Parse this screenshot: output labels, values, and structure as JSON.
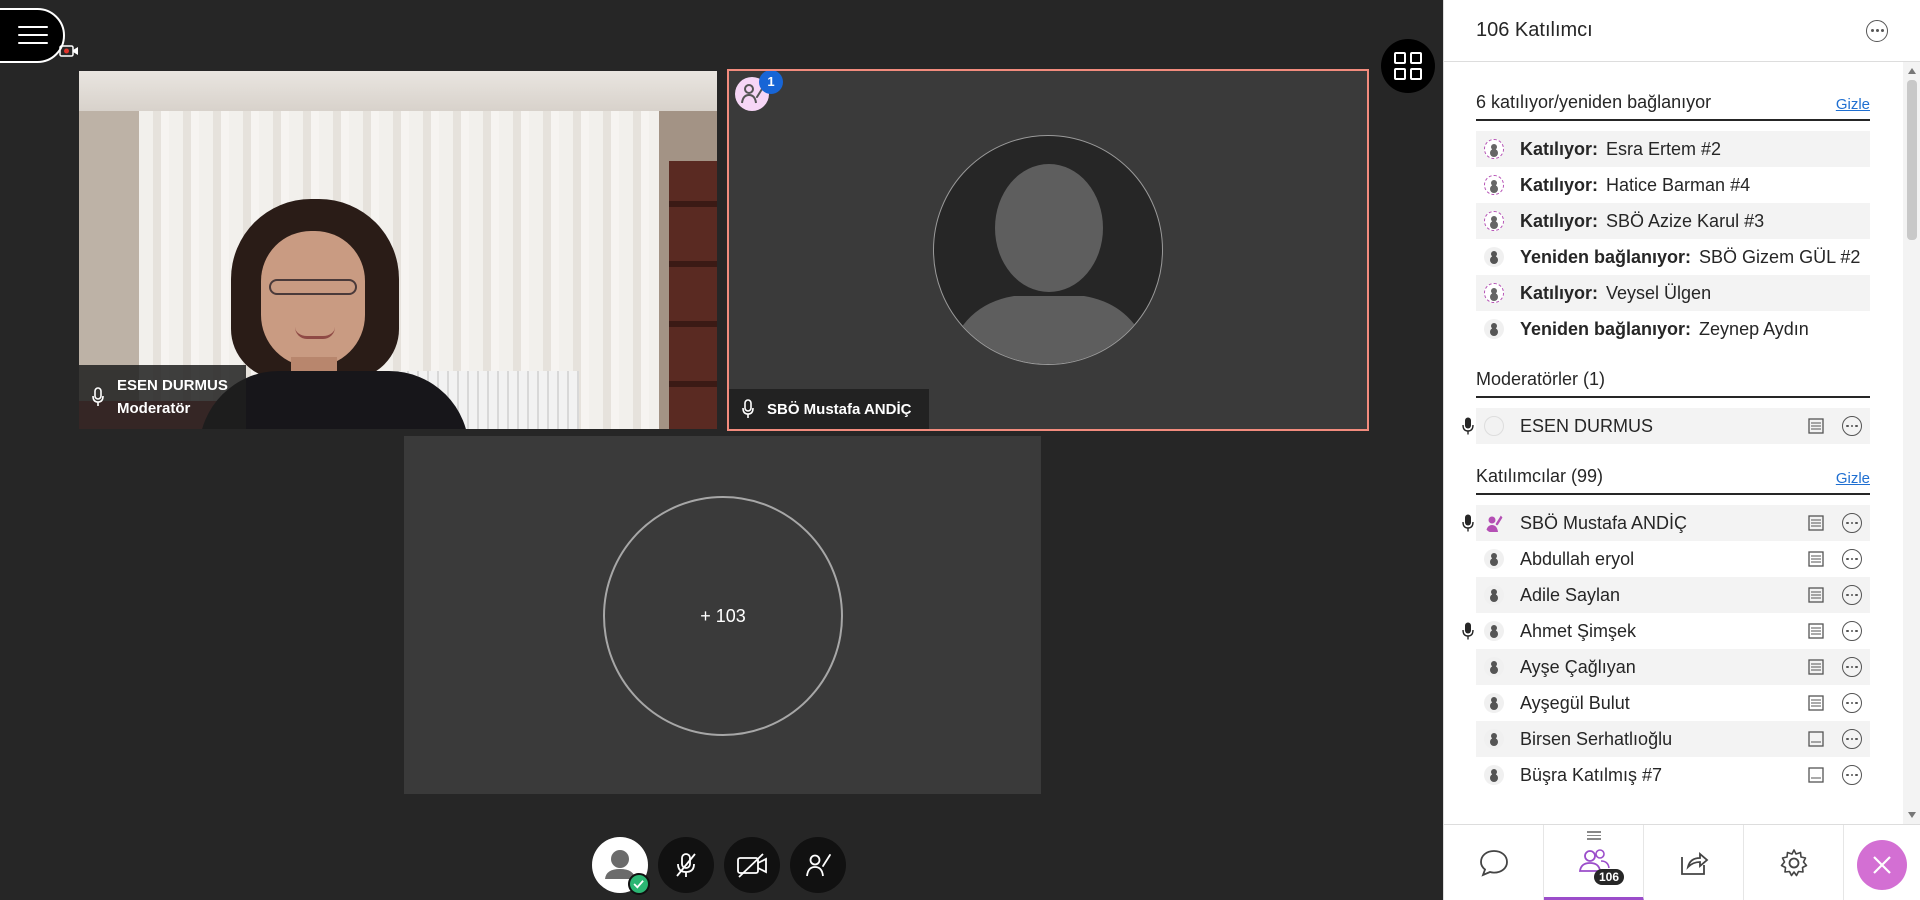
{
  "stage": {
    "tiles": {
      "esen": {
        "name": "ESEN DURMUS",
        "role": "Moderatör"
      },
      "mustafa": {
        "name": "SBÖ Mustafa ANDİÇ",
        "share_badge": "1"
      },
      "more": {
        "label": "+ 103"
      }
    }
  },
  "panel": {
    "title": "106 Katılımcı",
    "joining": {
      "heading": "6 katılıyor/yeniden bağlanıyor",
      "hide": "Gizle",
      "items": [
        {
          "status": "Katılıyor:",
          "name": "Esra Ertem #2"
        },
        {
          "status": "Katılıyor:",
          "name": "Hatice Barman #4"
        },
        {
          "status": "Katılıyor:",
          "name": "SBÖ Azize Karul #3"
        },
        {
          "status": "Yeniden bağlanıyor:",
          "name": "SBÖ Gizem GÜL #2"
        },
        {
          "status": "Katılıyor:",
          "name": "Veysel Ülgen"
        },
        {
          "status": "Yeniden bağlanıyor:",
          "name": "Zeynep Aydın"
        }
      ]
    },
    "moderators": {
      "heading": "Moderatörler (1)",
      "items": [
        {
          "name": "ESEN DURMUS"
        }
      ]
    },
    "participants": {
      "heading": "Katılımcılar (99)",
      "hide": "Gizle",
      "items": [
        {
          "name": "SBÖ Mustafa ANDİÇ"
        },
        {
          "name": "Abdullah eryol"
        },
        {
          "name": "Adile Saylan"
        },
        {
          "name": "Ahmet Şimşek"
        },
        {
          "name": "Ayşe Çağlıyan"
        },
        {
          "name": "Ayşegül Bulut"
        },
        {
          "name": "Birsen Serhatlıoğlu"
        },
        {
          "name": "Büşra Katılmış #7"
        }
      ]
    },
    "tabs": {
      "participants_count": "106"
    }
  },
  "colors": {
    "accent": "#9b4dca",
    "speaker_border": "#f28b7d",
    "link": "#1f6fd1",
    "close": "#d36fd3"
  }
}
